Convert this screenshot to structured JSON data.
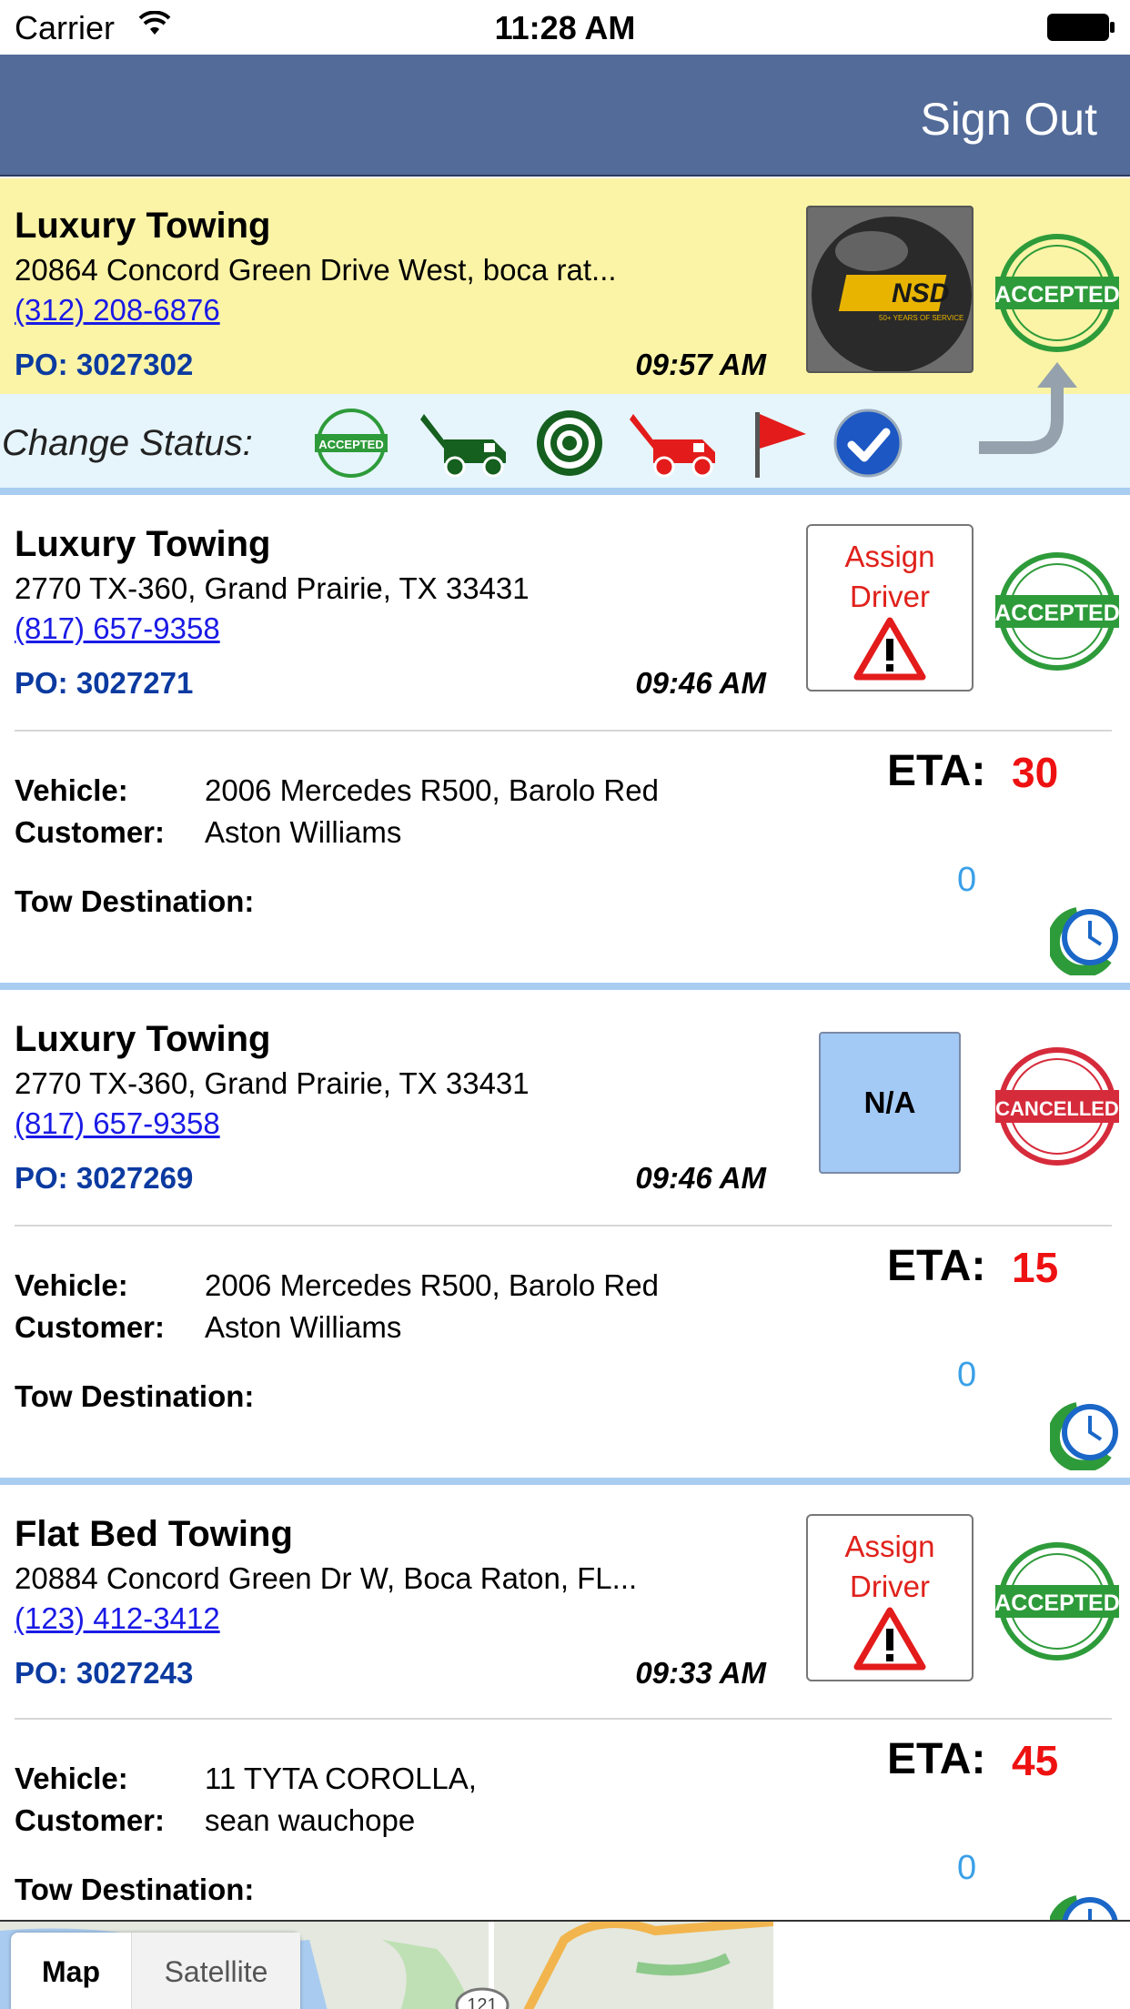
{
  "status_bar": {
    "carrier": "Carrier",
    "time": "11:28 AM"
  },
  "navbar": {
    "sign_out": "Sign Out"
  },
  "change_status": {
    "label": "Change Status:",
    "stamp_text": "ACCEPTED"
  },
  "jobs": [
    {
      "name": "Luxury Towing",
      "address": "20864 Concord Green Drive West, boca rat...",
      "phone": "(312) 208-6876",
      "po": "PO: 3027302",
      "time": "09:57 AM",
      "status": "ACCEPTED",
      "thumb_text": "NSD",
      "thumb_sub": "50+ YEARS OF SERVICE"
    },
    {
      "name": "Luxury Towing",
      "address": "2770 TX-360, Grand Prairie, TX 33431",
      "phone": "(817) 657-9358",
      "po": "PO: 3027271",
      "time": "09:46 AM",
      "action_line1": "Assign",
      "action_line2": "Driver",
      "status": "ACCEPTED",
      "vehicle_label": "Vehicle:",
      "vehicle": "2006 Mercedes R500, Barolo Red",
      "customer_label": "Customer:",
      "customer": "Aston Williams",
      "tow_label": "Tow Destination:",
      "eta_label": "ETA:",
      "eta": "30",
      "count": "0"
    },
    {
      "name": "Luxury Towing",
      "address": "2770 TX-360, Grand Prairie, TX 33431",
      "phone": "(817) 657-9358",
      "po": "PO: 3027269",
      "time": "09:46 AM",
      "action_na": "N/A",
      "status": "CANCELLED",
      "vehicle_label": "Vehicle:",
      "vehicle": "2006 Mercedes R500, Barolo Red",
      "customer_label": "Customer:",
      "customer": "Aston Williams",
      "tow_label": "Tow Destination:",
      "eta_label": "ETA:",
      "eta": "15",
      "count": "0"
    },
    {
      "name": "Flat Bed Towing",
      "address": "20884 Concord Green Dr W, Boca Raton, FL...",
      "phone": "(123) 412-3412",
      "po": "PO: 3027243",
      "time": "09:33 AM",
      "action_line1": "Assign",
      "action_line2": "Driver",
      "status": "ACCEPTED",
      "vehicle_label": "Vehicle:",
      "vehicle": "11 TYTA COROLLA,",
      "customer_label": "Customer:",
      "customer": "sean wauchope",
      "tow_label": "Tow Destination:",
      "eta_label": "ETA:",
      "eta": "45",
      "count": "0"
    }
  ],
  "map": {
    "tab_map": "Map",
    "tab_satellite": "Satellite",
    "road_label": "121"
  },
  "colors": {
    "nav": "#536b99",
    "selected_row": "#fbf4a6",
    "status_bar_bg": "#e6f5fc",
    "eta": "#ee1111",
    "stamp_green": "#2e9b3a",
    "stamp_red": "#d62b3b"
  }
}
